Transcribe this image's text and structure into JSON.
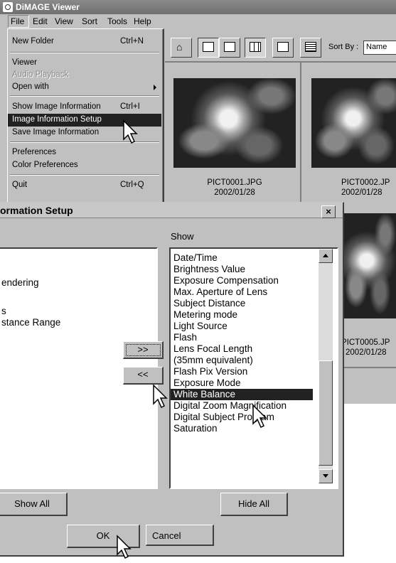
{
  "viewer": {
    "title": "DiMAGE Viewer",
    "menu": [
      "File",
      "Edit",
      "View",
      "Sort",
      "Tools",
      "Help"
    ],
    "file_menu": [
      {
        "label": "New Folder",
        "shortcut": "Ctrl+N"
      },
      {
        "label": "Viewer",
        "shortcut": ""
      },
      {
        "label": "Audio Playback",
        "shortcut": "",
        "disabled": true
      },
      {
        "label": "Open with",
        "shortcut": "",
        "submenu": true
      },
      {
        "label": "Show Image Information",
        "shortcut": "Ctrl+I"
      },
      {
        "label": "Image Information Setup",
        "shortcut": "",
        "highlighted": true
      },
      {
        "label": "Save Image Information",
        "shortcut": ""
      },
      {
        "label": "Preferences",
        "shortcut": ""
      },
      {
        "label": "Color Preferences",
        "shortcut": ""
      },
      {
        "label": "Quit",
        "shortcut": "Ctrl+Q"
      }
    ],
    "toolbar": {
      "icons": [
        "home-icon",
        "convert-icon",
        "camera-icon",
        "thumbnail-view-icon",
        "list-view-icon",
        "detail-view-icon"
      ],
      "sort_label": "Sort By :",
      "sort_value": "Name"
    },
    "thumbnails": [
      {
        "filename": "PICT0001.JPG",
        "date": "2002/01/28"
      },
      {
        "filename": "PICT0002.JP",
        "date": "2002/01/28"
      },
      {
        "filename": "PICT0005.JP",
        "date": "2002/01/28"
      }
    ]
  },
  "dialog": {
    "title": "ormation Setup",
    "close": "×",
    "hidden_items": [
      "endering",
      "s",
      "stance Range"
    ],
    "show_label": "Show",
    "shown_items": [
      "Date/Time",
      "Brightness Value",
      "Exposure Compensation",
      "Max. Aperture of Lens",
      "Subject Distance",
      "Metering mode",
      "Light Source",
      "Flash",
      "Lens Focal Length",
      "(35mm equivalent)",
      "Flash Pix Version",
      "Exposure Mode",
      "White Balance",
      "Digital Zoom Magnification",
      "Digital Subject Program",
      "Saturation"
    ],
    "selected_item": "White Balance",
    "add_button": ">>",
    "remove_button": "<<",
    "show_all": "Show All",
    "hide_all": "Hide All",
    "ok": "OK",
    "cancel": "Cancel"
  },
  "colors": {
    "highlight": "#222222",
    "face": "#c0c0c0",
    "titlebar": "#7a7a7a"
  }
}
